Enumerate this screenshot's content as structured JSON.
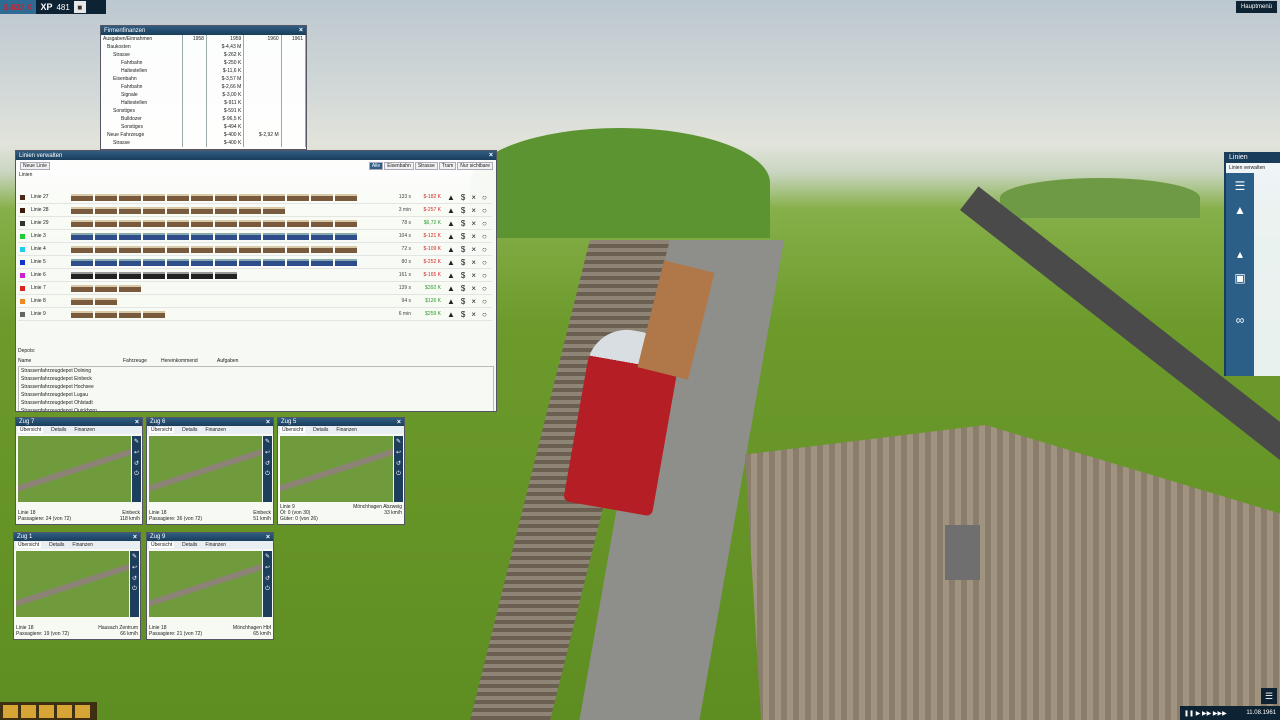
{
  "top": {
    "money": "$-633 K",
    "xp_label": "XP",
    "xp_value": "481",
    "mainmenu": "Hauptmenü"
  },
  "finance": {
    "title": "Firmenfinanzen",
    "columns": [
      "Ausgaben/Einnahmen",
      "1958",
      "1959",
      "1960",
      "1961"
    ],
    "rows": [
      [
        "Baukosten",
        "",
        "$-4,43 M",
        "",
        ""
      ],
      [
        "Strasse",
        "",
        "$-262 K",
        "",
        ""
      ],
      [
        "Fahrbahn",
        "",
        "$-250 K",
        "",
        ""
      ],
      [
        "Haltestellen",
        "",
        "$-11,6 K",
        "",
        ""
      ],
      [
        "Eisenbahn",
        "",
        "$-3,57 M",
        "",
        ""
      ],
      [
        "Fahrbahn",
        "",
        "$-2,66 M",
        "",
        ""
      ],
      [
        "Signale",
        "",
        "$-3,00 K",
        "",
        ""
      ],
      [
        "Haltestellen",
        "",
        "$-911 K",
        "",
        ""
      ],
      [
        "Sonstiges",
        "",
        "$-591 K",
        "",
        ""
      ],
      [
        "Bulldozer",
        "",
        "$-96,5 K",
        "",
        ""
      ],
      [
        "Sonstiges",
        "",
        "$-494 K",
        "",
        ""
      ],
      [
        "Neue Fahrzeuge",
        "",
        "$-400 K",
        "$-2,92 M",
        ""
      ],
      [
        "Strasse",
        "",
        "$-400 K",
        "",
        ""
      ]
    ]
  },
  "lines": {
    "title": "Linien verwalten",
    "new_line": "Neue Linie",
    "filters": [
      "Alle",
      "Eisenbahn",
      "Strasse",
      "Tram",
      "Nur sichtbare"
    ],
    "list_label": "Linien",
    "items": [
      {
        "name": "Linie 27",
        "color": "#4a2a1a",
        "cars": 12,
        "kind": "",
        "time": "133 s",
        "money": "$-182 K",
        "neg": true
      },
      {
        "name": "Linie 28",
        "color": "#3a1a0a",
        "cars": 9,
        "kind": "",
        "time": "3 min",
        "money": "$-257 K",
        "neg": true
      },
      {
        "name": "Linie 29",
        "color": "#333333",
        "cars": 12,
        "kind": "",
        "time": "78 s",
        "money": "$6,72 K",
        "neg": false
      },
      {
        "name": "Linie 3",
        "color": "#22cc33",
        "cars": 12,
        "kind": "b",
        "time": "104 s",
        "money": "$-121 K",
        "neg": true
      },
      {
        "name": "Linie 4",
        "color": "#22ccee",
        "cars": 12,
        "kind": "",
        "time": "72 s",
        "money": "$-109 K",
        "neg": true
      },
      {
        "name": "Linie 5",
        "color": "#1133cc",
        "cars": 12,
        "kind": "b",
        "time": "80 s",
        "money": "$-252 K",
        "neg": true
      },
      {
        "name": "Linie 6",
        "color": "#cc22cc",
        "cars": 7,
        "kind": "k",
        "time": "161 s",
        "money": "$-165 K",
        "neg": true
      },
      {
        "name": "Linie 7",
        "color": "#dd2222",
        "cars": 3,
        "kind": "",
        "time": "139 s",
        "money": "$392 K",
        "neg": false
      },
      {
        "name": "Linie 8",
        "color": "#ee8822",
        "cars": 2,
        "kind": "",
        "time": "94 s",
        "money": "$126 K",
        "neg": false
      },
      {
        "name": "Linie 9",
        "color": "#666666",
        "cars": 4,
        "kind": "",
        "time": "6 min",
        "money": "$259 K",
        "neg": false
      }
    ],
    "depots_label": "Depots:",
    "depot_columns": [
      "Name",
      "Fahrzeuge",
      "Hereinkommend",
      "Aufgaben"
    ],
    "depots": [
      "Strassenfahrzeugdepot Dolning",
      "Strassenfahrzeugdepot Einbeck",
      "Strassenfahrzeugdepot Hochsee",
      "Strassenfahrzeugdepot Lugau",
      "Strassenfahrzeugdepot Ohlstadt",
      "Strassenfahrzeugdepot Quickborn"
    ]
  },
  "trains": [
    {
      "title": "Zug 7",
      "tabs": [
        "Übersicht",
        "Details",
        "Finanzen"
      ],
      "line": "Linie 18",
      "load": "Passagiere: 24 (von 72)",
      "dest": "Einbeck",
      "speed": "118 km/h",
      "extra": ""
    },
    {
      "title": "Zug 6",
      "tabs": [
        "Übersicht",
        "Details",
        "Finanzen"
      ],
      "line": "Linie 18",
      "load": "Passagiere: 36 (von 72)",
      "dest": "Einbeck",
      "speed": "51 km/h",
      "extra": ""
    },
    {
      "title": "Zug 5",
      "tabs": [
        "Übersicht",
        "Details",
        "Finanzen"
      ],
      "line": "Linie 9",
      "load": "Öl: 0 (von 30)",
      "dest": "Mönchhagen Abzweig",
      "speed": "33 km/h",
      "extra": "Güter: 0 (von 26)"
    },
    {
      "title": "Zug 1",
      "tabs": [
        "Übersicht",
        "Details",
        "Finanzen"
      ],
      "line": "Linie 18",
      "load": "Passagiere: 19 (von 72)",
      "dest": "Hausach Zentrum",
      "speed": "66 km/h",
      "extra": ""
    },
    {
      "title": "Zug 9",
      "tabs": [
        "Übersicht",
        "Details",
        "Finanzen"
      ],
      "line": "Linie 18",
      "load": "Passagiere: 21 (von 72)",
      "dest": "Mönchhagen Hbf",
      "speed": "65 km/h",
      "extra": ""
    }
  ],
  "right_panel": {
    "title": "Linien",
    "subtitle": "Linien verwalten"
  },
  "date": "11.08.1961"
}
